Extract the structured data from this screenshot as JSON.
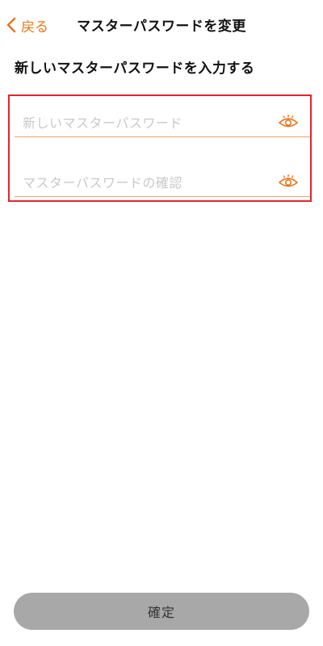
{
  "header": {
    "back_label": "戻る",
    "title": "マスターパスワードを変更"
  },
  "section": {
    "heading": "新しいマスターパスワードを入力する"
  },
  "fields": {
    "new_password": {
      "value": "",
      "placeholder": "新しいマスターパスワード",
      "icon": "eye-icon"
    },
    "confirm_password": {
      "value": "",
      "placeholder": "マスターパスワードの確認",
      "icon": "eye-icon"
    }
  },
  "footer": {
    "confirm_label": "確定"
  },
  "colors": {
    "accent": "#e8771e",
    "highlight_border": "#e2242d",
    "disabled_button": "#a8a8a8"
  }
}
